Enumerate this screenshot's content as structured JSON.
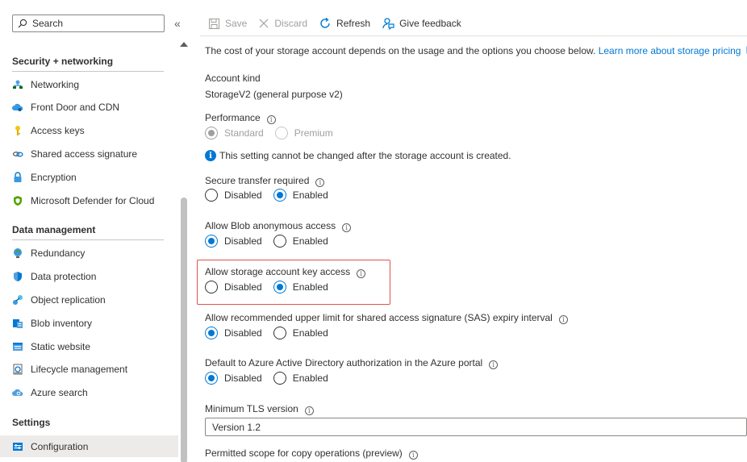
{
  "sidebar": {
    "search_placeholder": "Search",
    "collapse_glyph": "«",
    "sections": [
      {
        "title": "Security + networking",
        "items": [
          {
            "label": "Networking",
            "icon": "networking-icon"
          },
          {
            "label": "Front Door and CDN",
            "icon": "cloud-icon"
          },
          {
            "label": "Access keys",
            "icon": "key-icon"
          },
          {
            "label": "Shared access signature",
            "icon": "link-icon"
          },
          {
            "label": "Encryption",
            "icon": "lock-icon"
          },
          {
            "label": "Microsoft Defender for Cloud",
            "icon": "shield-icon"
          }
        ]
      },
      {
        "title": "Data management",
        "items": [
          {
            "label": "Redundancy",
            "icon": "globe-icon"
          },
          {
            "label": "Data protection",
            "icon": "shield-icon"
          },
          {
            "label": "Object replication",
            "icon": "replication-icon"
          },
          {
            "label": "Blob inventory",
            "icon": "inventory-icon"
          },
          {
            "label": "Static website",
            "icon": "website-icon"
          },
          {
            "label": "Lifecycle management",
            "icon": "lifecycle-icon"
          },
          {
            "label": "Azure search",
            "icon": "cloud-search-icon"
          }
        ]
      },
      {
        "title": "Settings",
        "items": [
          {
            "label": "Configuration",
            "icon": "configuration-icon",
            "selected": true
          }
        ]
      }
    ]
  },
  "toolbar": {
    "save": "Save",
    "discard": "Discard",
    "refresh": "Refresh",
    "feedback": "Give feedback"
  },
  "content": {
    "intro": "The cost of your storage account depends on the usage and the options you choose below.",
    "intro_link": "Learn more about storage pricing",
    "account_kind_label": "Account kind",
    "account_kind_value": "StorageV2 (general purpose v2)",
    "performance": {
      "label": "Performance",
      "options": [
        "Standard",
        "Premium"
      ],
      "selected": "Standard",
      "disabled": true
    },
    "performance_note": "This setting cannot be changed after the storage account is created.",
    "secure_transfer": {
      "label": "Secure transfer required",
      "options": [
        "Disabled",
        "Enabled"
      ],
      "selected": "Enabled"
    },
    "blob_anonymous": {
      "label": "Allow Blob anonymous access",
      "options": [
        "Disabled",
        "Enabled"
      ],
      "selected": "Disabled"
    },
    "key_access": {
      "label": "Allow storage account key access",
      "options": [
        "Disabled",
        "Enabled"
      ],
      "selected": "Enabled"
    },
    "sas_expiry": {
      "label": "Allow recommended upper limit for shared access signature (SAS) expiry interval",
      "options": [
        "Disabled",
        "Enabled"
      ],
      "selected": "Disabled"
    },
    "aad_default": {
      "label": "Default to Azure Active Directory authorization in the Azure portal",
      "options": [
        "Disabled",
        "Enabled"
      ],
      "selected": "Disabled"
    },
    "tls": {
      "label": "Minimum TLS version",
      "value": "Version 1.2"
    },
    "copy_scope": {
      "label": "Permitted scope for copy operations (preview)"
    }
  },
  "colors": {
    "accent": "#0078d4",
    "highlight_border": "#e05252",
    "selected_nav": "#edebe9"
  }
}
